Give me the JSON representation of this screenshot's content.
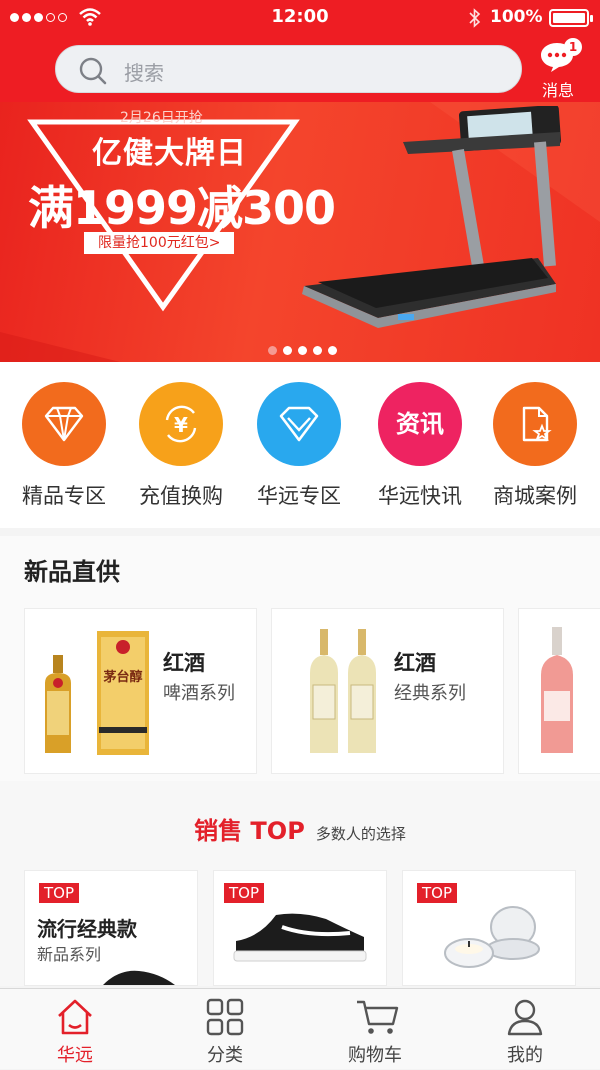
{
  "status_bar": {
    "time": "12:00",
    "battery": "100%"
  },
  "search": {
    "placeholder": "搜索"
  },
  "messages": {
    "label": "消息",
    "badge": "1"
  },
  "banner": {
    "date": "2月26日开抢",
    "title": "亿健大牌日",
    "promo": "满1999减300",
    "coupon": "限量抢100元红包>",
    "slide_count": 5,
    "active_slide": 1
  },
  "quick_entries": [
    {
      "label": "精品专区",
      "icon": "diamond-icon",
      "color": "#f26b1d"
    },
    {
      "label": "充值换购",
      "icon": "yen-exchange-icon",
      "color": "#f7a11a"
    },
    {
      "label": "华远专区",
      "icon": "gem-icon",
      "color": "#29a8ee"
    },
    {
      "label": "华远快讯",
      "icon": "资讯",
      "color": "#ee2361"
    },
    {
      "label": "商城案例",
      "icon": "document-star-icon",
      "color": "#f26b1d"
    }
  ],
  "new_products": {
    "title": "新品直供",
    "items": [
      {
        "name": "红酒",
        "sub": "啤酒系列"
      },
      {
        "name": "红酒",
        "sub": "经典系列"
      }
    ]
  },
  "sales_top": {
    "title": "销售 TOP",
    "subtitle": "多数人的选择",
    "tag": "TOP",
    "items": [
      {
        "title": "流行经典款",
        "sub": "新品系列"
      }
    ]
  },
  "tabs": [
    {
      "label": "华远",
      "icon": "home-icon",
      "active": true
    },
    {
      "label": "分类",
      "icon": "grid-icon",
      "active": false
    },
    {
      "label": "购物车",
      "icon": "cart-icon",
      "active": false
    },
    {
      "label": "我的",
      "icon": "user-icon",
      "active": false
    }
  ],
  "colors": {
    "brand_red": "#ee1d23",
    "accent_red": "#e3202a"
  }
}
